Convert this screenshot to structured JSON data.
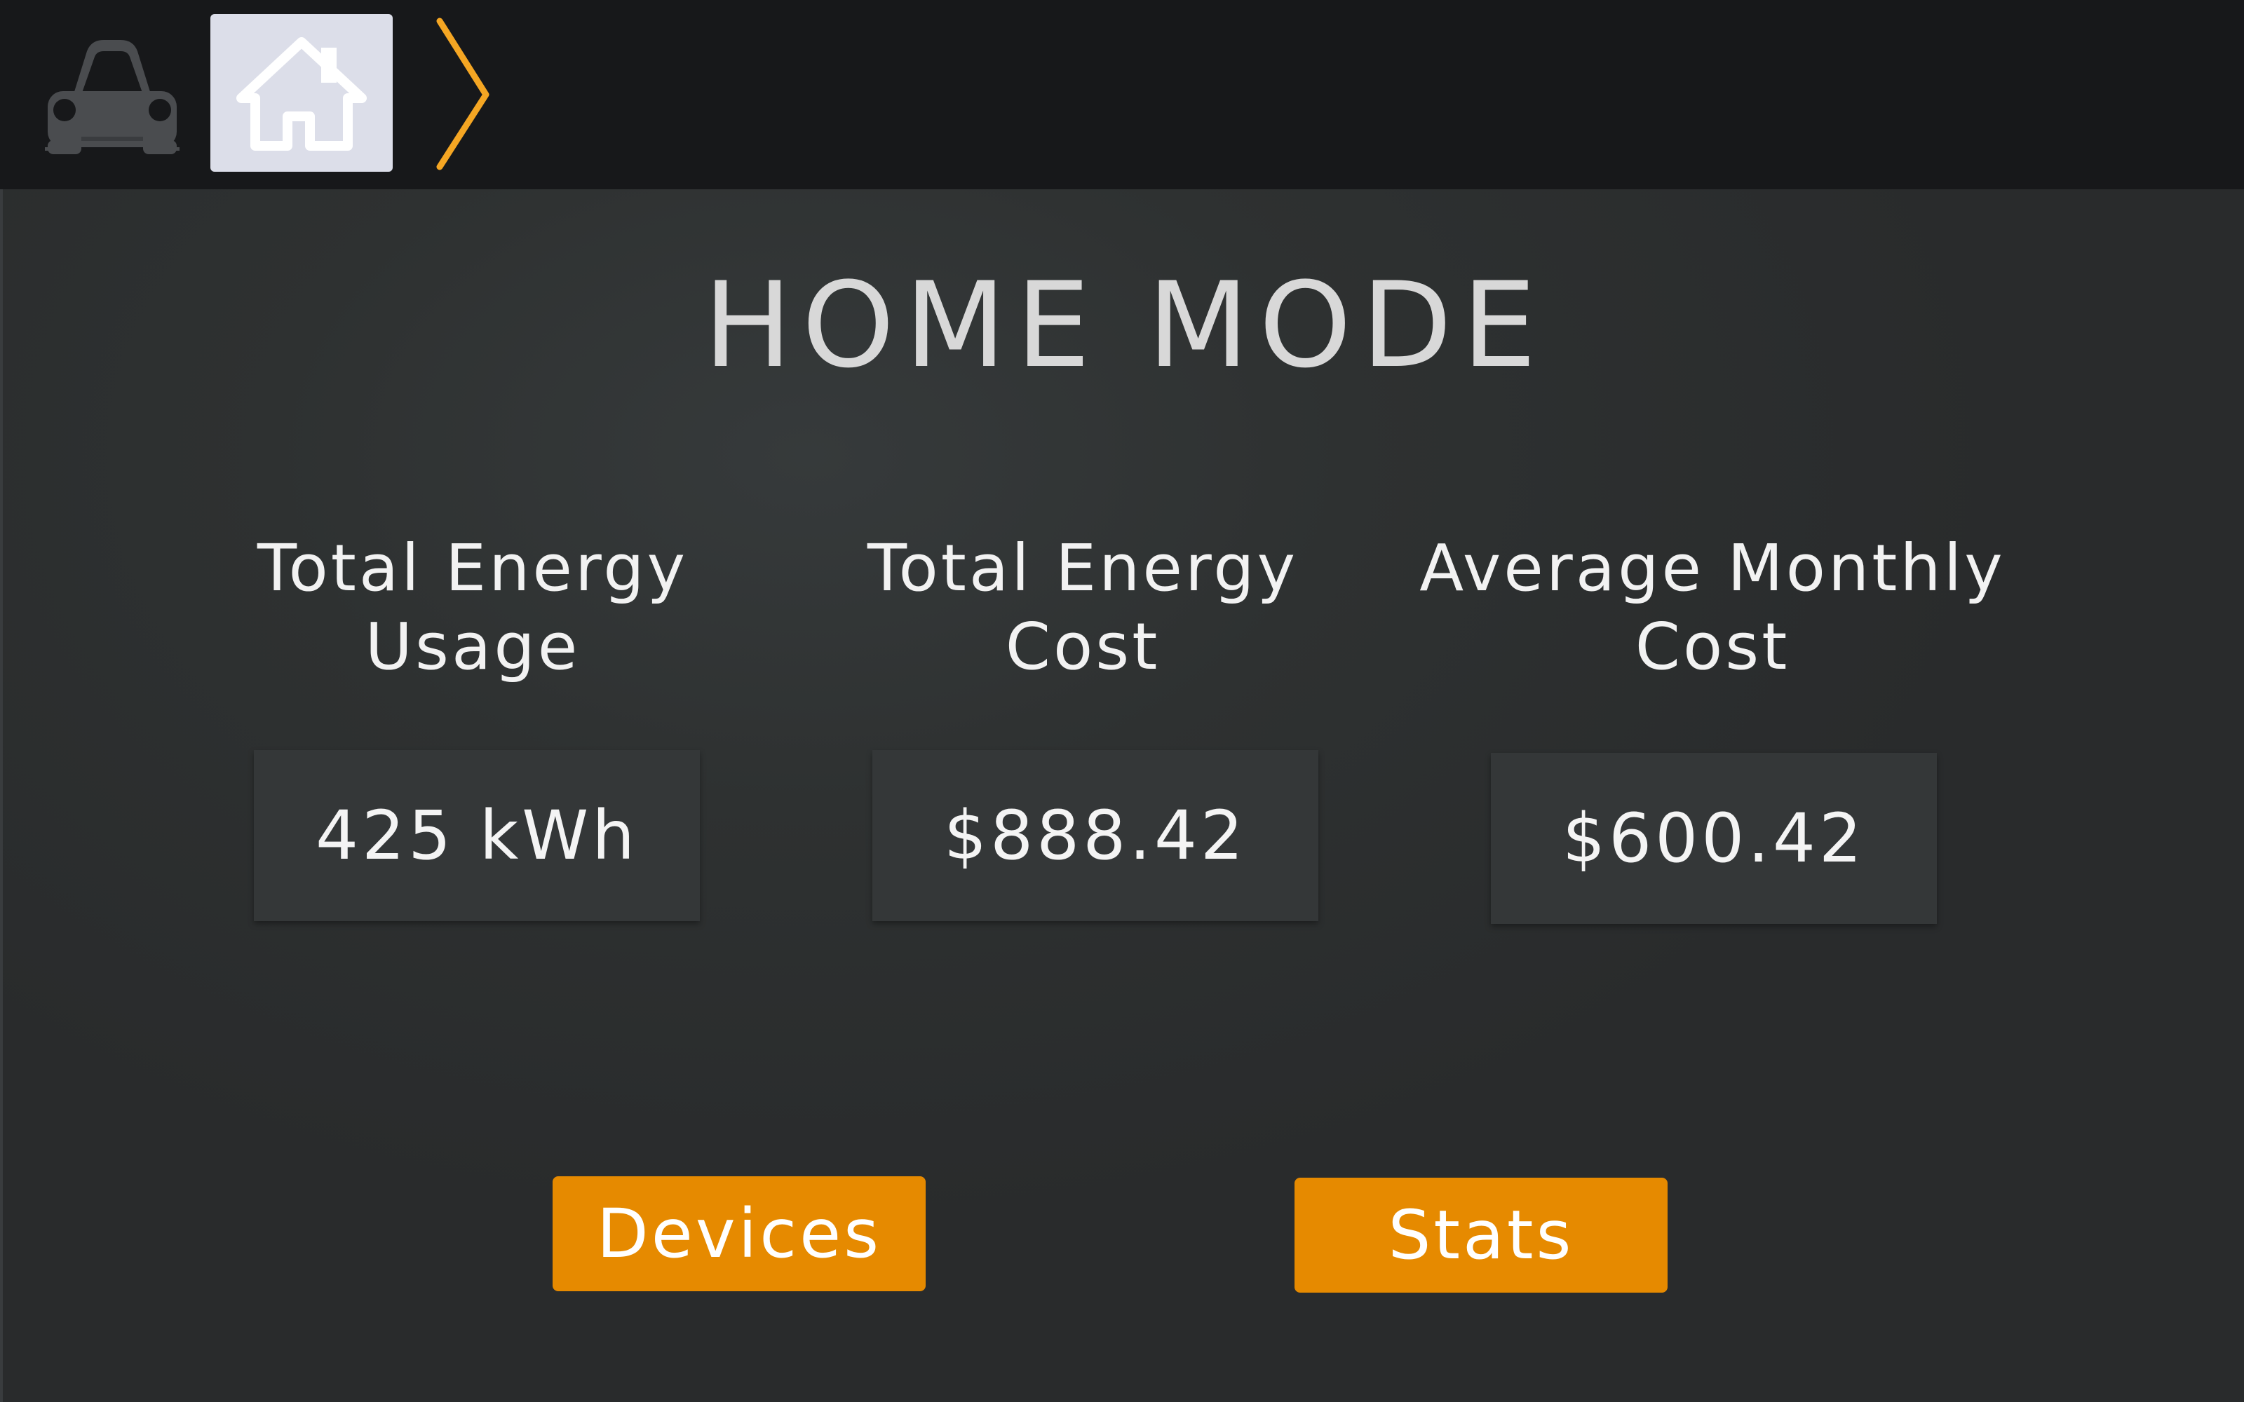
{
  "nav": {
    "car_icon": "car-icon",
    "home_icon": "home-icon",
    "chevron_icon": "chevron-right-icon",
    "accent_color": "#f5a623",
    "active_tab_color": "#dcdee9"
  },
  "main": {
    "title": "HOME MODE",
    "stats": [
      {
        "label_line1": "Total Energy",
        "label_line2": "Usage",
        "value": "425 kWh"
      },
      {
        "label_line1": "Total Energy",
        "label_line2": "Cost",
        "value": "$888.42"
      },
      {
        "label_line1": "Average Monthly",
        "label_line2": "Cost",
        "value": "$600.42"
      }
    ]
  },
  "buttons": {
    "devices_label": "Devices",
    "stats_label": "Stats",
    "color": "#e68a00"
  }
}
